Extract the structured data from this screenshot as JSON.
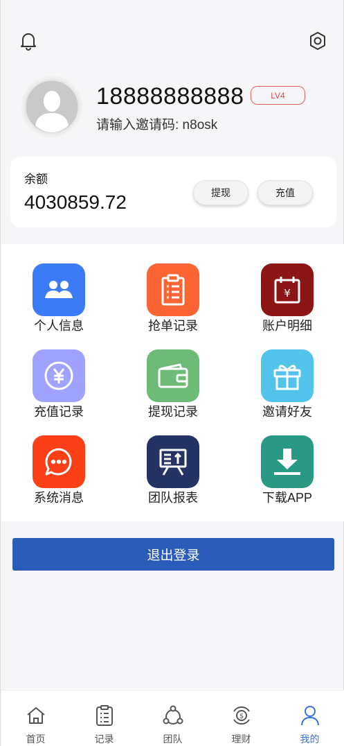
{
  "header": {
    "bell_icon": "bell-icon",
    "settings_icon": "gear-icon"
  },
  "profile": {
    "avatar_icon": "user-avatar-icon",
    "phone": "18888888888",
    "level": "LV4",
    "invite_text": "请输入邀请码: n8osk"
  },
  "balance": {
    "label": "余额",
    "value": "4030859.72",
    "withdraw_label": "提现",
    "recharge_label": "充值"
  },
  "menu": [
    {
      "label": "个人信息",
      "icon": "users-icon",
      "color": "#3b7cf6"
    },
    {
      "label": "抢单记录",
      "icon": "clipboard-icon",
      "color": "#fb6435"
    },
    {
      "label": "账户明细",
      "icon": "calendar-yen-icon",
      "color": "#8c1616"
    },
    {
      "label": "充值记录",
      "icon": "yen-circle-icon",
      "color": "#9fa3ff"
    },
    {
      "label": "提现记录",
      "icon": "wallet-icon",
      "color": "#6ebb78"
    },
    {
      "label": "邀请好友",
      "icon": "gift-icon",
      "color": "#52c4ec"
    },
    {
      "label": "系统消息",
      "icon": "chat-bubble-icon",
      "color": "#fb3f17"
    },
    {
      "label": "团队报表",
      "icon": "presentation-board-icon",
      "color": "#243363"
    },
    {
      "label": "下载APP",
      "icon": "download-icon",
      "color": "#2a9983"
    }
  ],
  "logout_label": "退出登录",
  "tabs": [
    {
      "label": "首页",
      "icon": "home-icon"
    },
    {
      "label": "记录",
      "icon": "list-icon"
    },
    {
      "label": "团队",
      "icon": "team-icon"
    },
    {
      "label": "理财",
      "icon": "finance-icon"
    },
    {
      "label": "我的",
      "icon": "user-icon"
    }
  ],
  "colors": {
    "accent": "#2b5cb9",
    "tab_active": "#3a6fe0",
    "level_badge": "#e04848"
  }
}
